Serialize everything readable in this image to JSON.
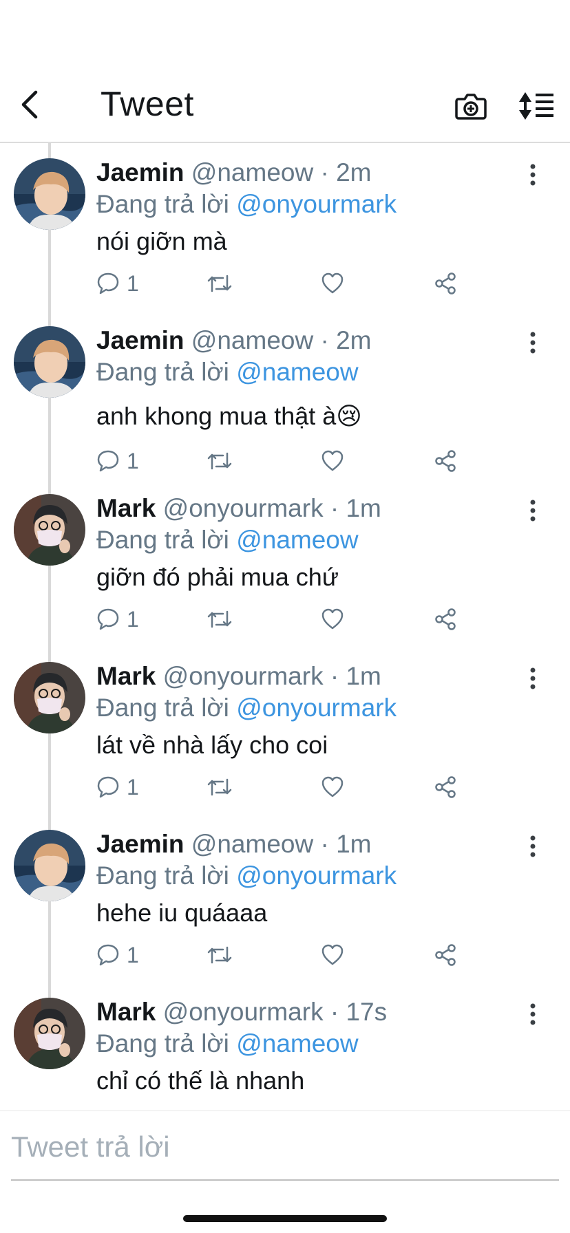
{
  "nav": {
    "title": "Tweet",
    "back_icon": "chevron-left-icon",
    "camera_icon": "camera-plus-icon",
    "sort_icon": "sort-list-icon"
  },
  "tweets": [
    {
      "name": "Jaemin",
      "handle": "@nameow",
      "time": "· 2m",
      "reply_prefix": "Đang trả lời",
      "reply_to": "@onyourmark",
      "text": "nói giỡn mà",
      "emoji": "",
      "reply_count": "1"
    },
    {
      "name": "Jaemin",
      "handle": "@nameow",
      "time": "· 2m",
      "reply_prefix": "Đang trả lời",
      "reply_to": "@nameow",
      "text": "anh khong mua thật à",
      "emoji": "😢",
      "reply_count": "1"
    },
    {
      "name": "Mark",
      "handle": "@onyourmark",
      "time": "· 1m",
      "reply_prefix": "Đang trả lời",
      "reply_to": "@nameow",
      "text": "giỡn đó phải mua chứ",
      "emoji": "",
      "reply_count": "1"
    },
    {
      "name": "Mark",
      "handle": "@onyourmark",
      "time": "· 1m",
      "reply_prefix": "Đang trả lời",
      "reply_to": "@onyourmark",
      "text": "lát về nhà lấy cho coi",
      "emoji": "",
      "reply_count": "1"
    },
    {
      "name": "Jaemin",
      "handle": "@nameow",
      "time": "· 1m",
      "reply_prefix": "Đang trả lời",
      "reply_to": "@onyourmark",
      "text": "hehe iu quáaaa",
      "emoji": "",
      "reply_count": "1"
    },
    {
      "name": "Mark",
      "handle": "@onyourmark",
      "time": "· 17s",
      "reply_prefix": "Đang trả lời",
      "reply_to": "@nameow",
      "text": "chỉ có thế là nhanh",
      "emoji": "",
      "reply_count": ""
    }
  ],
  "compose": {
    "placeholder": "Tweet trả lời",
    "value": ""
  },
  "colors": {
    "link": "#3d95e0",
    "secondary_text": "#657786",
    "thread_line": "#d9d9d9"
  }
}
